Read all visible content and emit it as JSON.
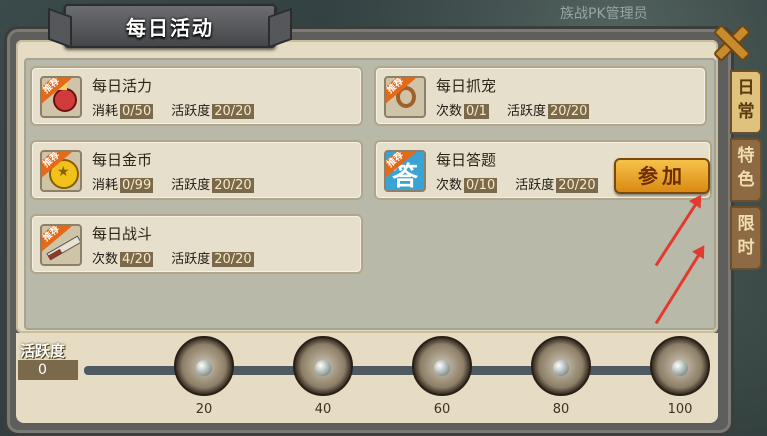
{
  "window": {
    "title": "每日活动",
    "map_label": "族战PK管理员"
  },
  "activities": [
    {
      "title": "每日活力",
      "badge": "推荐",
      "stat1_label": "消耗",
      "stat1_value": "0/50",
      "stat2_label": "活跃度",
      "stat2_value": "20/20",
      "icon": "red-potion-icon"
    },
    {
      "title": "每日抓宠",
      "badge": "推荐",
      "stat1_label": "次数",
      "stat1_value": "0/1",
      "stat2_label": "活跃度",
      "stat2_value": "20/20",
      "icon": "rope-lasso-icon"
    },
    {
      "title": "每日金币",
      "badge": "推荐",
      "stat1_label": "消耗",
      "stat1_value": "0/99",
      "stat2_label": "活跃度",
      "stat2_value": "20/20",
      "icon": "gold-coin-icon"
    },
    {
      "title": "每日答题",
      "badge": "推荐",
      "stat1_label": "次数",
      "stat1_value": "0/10",
      "stat2_label": "活跃度",
      "stat2_value": "20/20",
      "icon": "answer-icon",
      "icon_glyph": "答"
    },
    {
      "title": "每日战斗",
      "badge": "推荐",
      "stat1_label": "次数",
      "stat1_value": "4/20",
      "stat2_label": "活跃度",
      "stat2_value": "20/20",
      "icon": "crossed-swords-icon"
    }
  ],
  "join_button": "参加",
  "tabs": [
    {
      "label": "日常",
      "active": true
    },
    {
      "label": "特色",
      "active": false
    },
    {
      "label": "限时",
      "active": false
    }
  ],
  "activity_progress": {
    "label": "活跃度",
    "value": "0",
    "fill_fraction": 0.0,
    "milestones": [
      "20",
      "40",
      "60",
      "80",
      "100"
    ]
  },
  "colors": {
    "accent": "#d98a13",
    "arrow": "#e23a2f",
    "parchment": "#e6dcc4"
  }
}
